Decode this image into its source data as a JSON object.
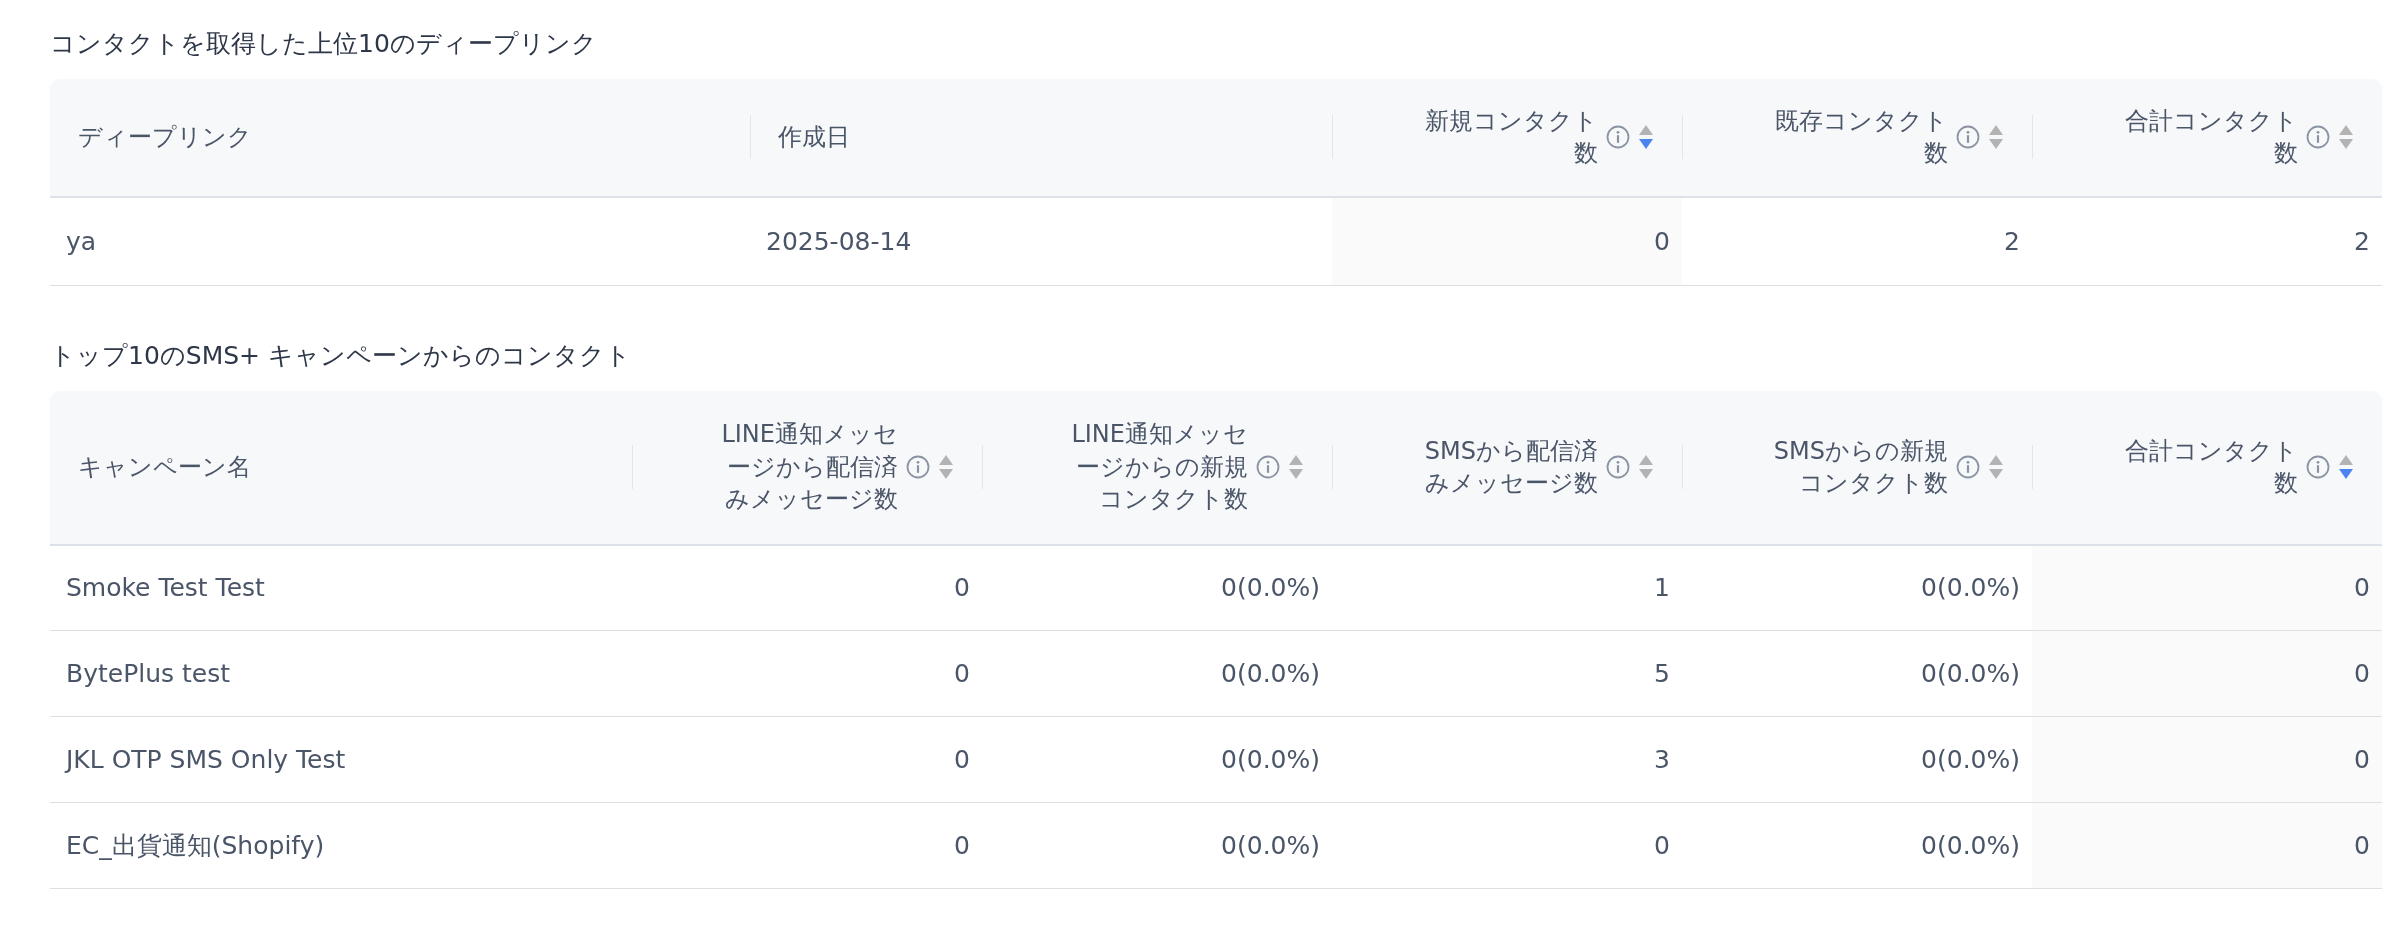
{
  "sections": [
    {
      "title": "コンタクトを取得した上位10のディープリンク",
      "columns": [
        {
          "label": "ディープリンク",
          "kind": "text"
        },
        {
          "label": "作成日",
          "kind": "text"
        },
        {
          "label": "新規コンタクト数",
          "kind": "metric",
          "sorted_descending": true
        },
        {
          "label": "既存コンタクト数",
          "kind": "metric",
          "sorted_descending": false
        },
        {
          "label": "合計コンタクト数",
          "kind": "metric",
          "sorted_descending": false
        }
      ],
      "rows": [
        [
          "ya",
          "2025-08-14",
          "0",
          "2",
          "2"
        ]
      ]
    },
    {
      "title": "トップ10のSMS+ キャンペーンからのコンタクト",
      "columns": [
        {
          "label": "キャンペーン名",
          "kind": "text"
        },
        {
          "label": "LINE通知メッセージから配信済みメッセージ数",
          "kind": "metric",
          "sorted_descending": false
        },
        {
          "label": "LINE通知メッセージからの新規コンタクト数",
          "kind": "metric",
          "sorted_descending": false
        },
        {
          "label": "SMSから配信済みメッセージ数",
          "kind": "metric",
          "sorted_descending": false
        },
        {
          "label": "SMSからの新規コンタクト数",
          "kind": "metric",
          "sorted_descending": false
        },
        {
          "label": "合計コンタクト数",
          "kind": "metric",
          "sorted_descending": true
        }
      ],
      "rows": [
        [
          "Smoke Test Test",
          "0",
          "0(0.0%)",
          "1",
          "0(0.0%)",
          "0"
        ],
        [
          "BytePlus test",
          "0",
          "0(0.0%)",
          "5",
          "0(0.0%)",
          "0"
        ],
        [
          "JKL OTP SMS Only Test",
          "0",
          "0(0.0%)",
          "3",
          "0(0.0%)",
          "0"
        ],
        [
          "EC_出貨通知(Shopify)",
          "0",
          "0(0.0%)",
          "0",
          "0(0.0%)",
          "0"
        ]
      ]
    }
  ]
}
